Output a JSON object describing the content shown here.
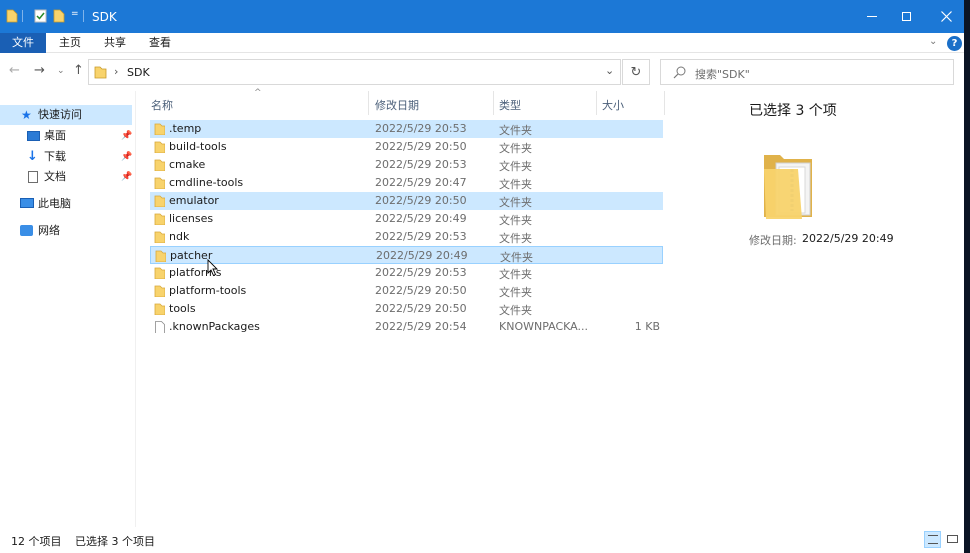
{
  "window": {
    "title": "SDK",
    "controls": [
      "minimize",
      "maximize",
      "close"
    ]
  },
  "ribbon": {
    "tabs": [
      "文件",
      "主页",
      "共享",
      "查看"
    ]
  },
  "address": {
    "separator": "›",
    "path": "SDK",
    "search_placeholder": "搜索\"SDK\""
  },
  "nav": {
    "quick_access": "快速访问",
    "desktop": "桌面",
    "downloads": "下载",
    "documents": "文档",
    "this_pc": "此电脑",
    "network": "网络"
  },
  "columns": {
    "name": "名称",
    "date": "修改日期",
    "type": "类型",
    "size": "大小"
  },
  "files": [
    {
      "name": ".temp",
      "date": "2022/5/29 20:53",
      "type": "文件夹",
      "size": "",
      "kind": "folder",
      "state": "selected"
    },
    {
      "name": "build-tools",
      "date": "2022/5/29 20:50",
      "type": "文件夹",
      "size": "",
      "kind": "folder",
      "state": ""
    },
    {
      "name": "cmake",
      "date": "2022/5/29 20:53",
      "type": "文件夹",
      "size": "",
      "kind": "folder",
      "state": ""
    },
    {
      "name": "cmdline-tools",
      "date": "2022/5/29 20:47",
      "type": "文件夹",
      "size": "",
      "kind": "folder",
      "state": ""
    },
    {
      "name": "emulator",
      "date": "2022/5/29 20:50",
      "type": "文件夹",
      "size": "",
      "kind": "folder",
      "state": "selected"
    },
    {
      "name": "licenses",
      "date": "2022/5/29 20:49",
      "type": "文件夹",
      "size": "",
      "kind": "folder",
      "state": ""
    },
    {
      "name": "ndk",
      "date": "2022/5/29 20:53",
      "type": "文件夹",
      "size": "",
      "kind": "folder",
      "state": ""
    },
    {
      "name": "patcher",
      "date": "2022/5/29 20:49",
      "type": "文件夹",
      "size": "",
      "kind": "folder",
      "state": "focused"
    },
    {
      "name": "platforms",
      "date": "2022/5/29 20:53",
      "type": "文件夹",
      "size": "",
      "kind": "folder",
      "state": ""
    },
    {
      "name": "platform-tools",
      "date": "2022/5/29 20:50",
      "type": "文件夹",
      "size": "",
      "kind": "folder",
      "state": ""
    },
    {
      "name": "tools",
      "date": "2022/5/29 20:50",
      "type": "文件夹",
      "size": "",
      "kind": "folder",
      "state": ""
    },
    {
      "name": ".knownPackages",
      "date": "2022/5/29 20:54",
      "type": "KNOWNPACKA...",
      "size": "1 KB",
      "kind": "file",
      "state": ""
    }
  ],
  "details": {
    "heading": "已选择 3 个项",
    "modified_label": "修改日期:",
    "modified_value": "2022/5/29 20:49"
  },
  "status": {
    "count": "12 个项目",
    "selected": "已选择 3 个项目"
  },
  "colors": {
    "titlebar": "#1c78d6",
    "file_tab": "#1a5fb4",
    "selection": "#cce8ff",
    "folder": "#f8d36c"
  }
}
